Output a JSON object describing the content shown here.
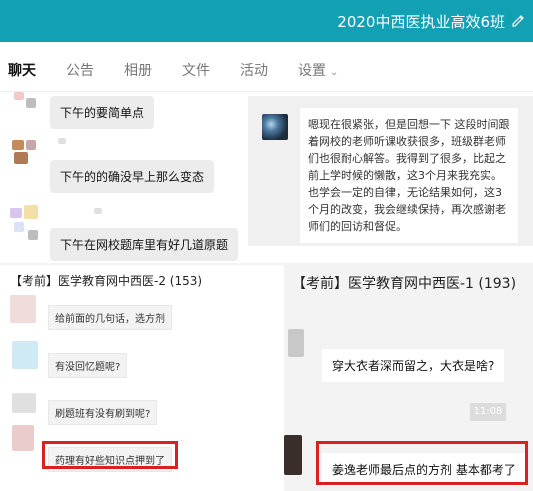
{
  "header": {
    "title": "2020中西医执业高效6班",
    "edit_icon": "pencil-icon"
  },
  "tabs": [
    {
      "label": "聊天",
      "active": true
    },
    {
      "label": "公告"
    },
    {
      "label": "相册"
    },
    {
      "label": "文件"
    },
    {
      "label": "活动"
    },
    {
      "label": "设置",
      "has_dropdown": true
    }
  ],
  "chat": {
    "messages": [
      "下午的要简单点",
      "下午的的确没早上那么变态",
      "下午在网校题库里有好几道原题"
    ],
    "long_message": "嗯现在很紧张，但是回想一下 这段时间跟着网校的老师听课收获很多，班级群老师们也很耐心解答。我得到了很多，比起之前上学时候的懒散，这3个月来我充实。也学会一定的自律，无论结果如何，这3个月的改变，我会继续保持，再次感谢老师们的回访和督促。"
  },
  "left_screenshot": {
    "title": "【考前】医学教育网中西医-2 (153)",
    "messages": [
      "给前面的几句话，选方剂",
      "有没回忆题呢?",
      "刷题班有没有刷到呢?",
      "药理有好些知识点押到了"
    ]
  },
  "right_screenshot": {
    "title": "【考前】医学教育网中西医-1 (193)",
    "messages": [
      "穿大衣者深而留之，大衣是啥?",
      "姜逸老师最后点的方剂 基本都考了"
    ],
    "time": "11:08"
  },
  "colors": {
    "header": "#12a0b5",
    "highlight": "#d9211f"
  }
}
